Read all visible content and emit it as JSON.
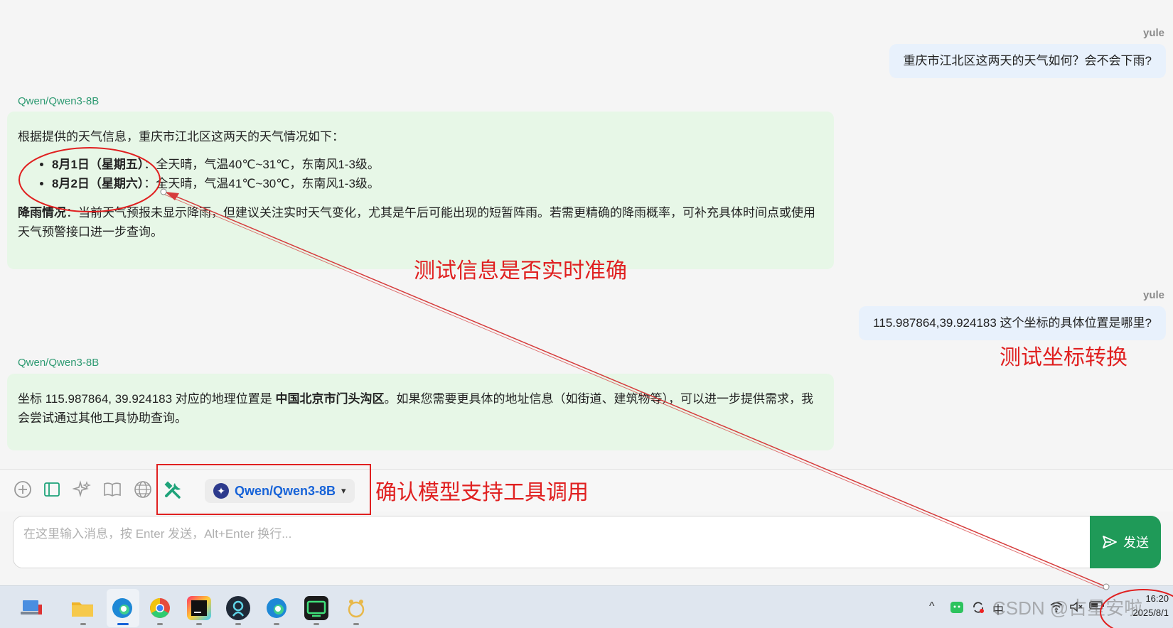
{
  "messages": [
    {
      "role": "user",
      "sender": "yule",
      "text": "重庆市江北区这两天的天气如何？会不会下雨?"
    },
    {
      "role": "assistant",
      "sender": "Qwen/Qwen3-8B",
      "intro": "根据提供的天气信息，重庆市江北区这两天的天气情况如下：",
      "items": [
        {
          "label": "8月1日（星期五）",
          "text": "：全天晴，气温40℃~31℃，东南风1-3级。"
        },
        {
          "label": "8月2日（星期六）",
          "text": "：全天晴，气温41℃~30℃，东南风1-3级。"
        }
      ],
      "rain_label": "降雨情况",
      "rain_text": "：当前天气预报未显示降雨，但建议关注实时天气变化，尤其是午后可能出现的短暂阵雨。若需更精确的降雨概率，可补充具体时间点或使用天气预警接口进一步查询。"
    },
    {
      "role": "user",
      "sender": "yule",
      "text": "115.987864,39.924183 这个坐标的具体位置是哪里?"
    },
    {
      "role": "assistant",
      "sender": "Qwen/Qwen3-8B",
      "pre": "坐标 115.987864, 39.924183 对应的地理位置是 ",
      "bold": "中国北京市门头沟区",
      "post": "。如果您需要更具体的地址信息（如街道、建筑物等），可以进一步提供需求，我会尝试通过其他工具协助查询。"
    }
  ],
  "annotations": {
    "realtime": "测试信息是否实时准确",
    "coord": "测试坐标转换",
    "tool": "确认模型支持工具调用"
  },
  "toolbar": {
    "icons": [
      "plus-circle-icon",
      "panel-icon",
      "sparkle-icon",
      "book-icon",
      "globe-icon",
      "tools-icon"
    ],
    "model_name": "Qwen/Qwen3-8B"
  },
  "input": {
    "placeholder": "在这里输入消息，按 Enter 发送，Alt+Enter 换行...",
    "value": "",
    "send_label": "发送"
  },
  "taskbar": {
    "apps": [
      "laptop-app",
      "file-explorer",
      "edge-browser",
      "chrome-browser",
      "jetbrains-ide",
      "app-dark",
      "edge-browser-2",
      "terminal-app",
      "paw-app"
    ],
    "tray_chevron": "^",
    "ime": "中",
    "time": "16:20",
    "date": "2025/8/1"
  },
  "watermark": "CSDN @占星安啦",
  "colors": {
    "annotation": "#e02020",
    "send_button": "#1f9a58",
    "model_text": "#1763d8",
    "ai_bubble": "#e7f7e7",
    "user_bubble": "#e8f1fc"
  }
}
